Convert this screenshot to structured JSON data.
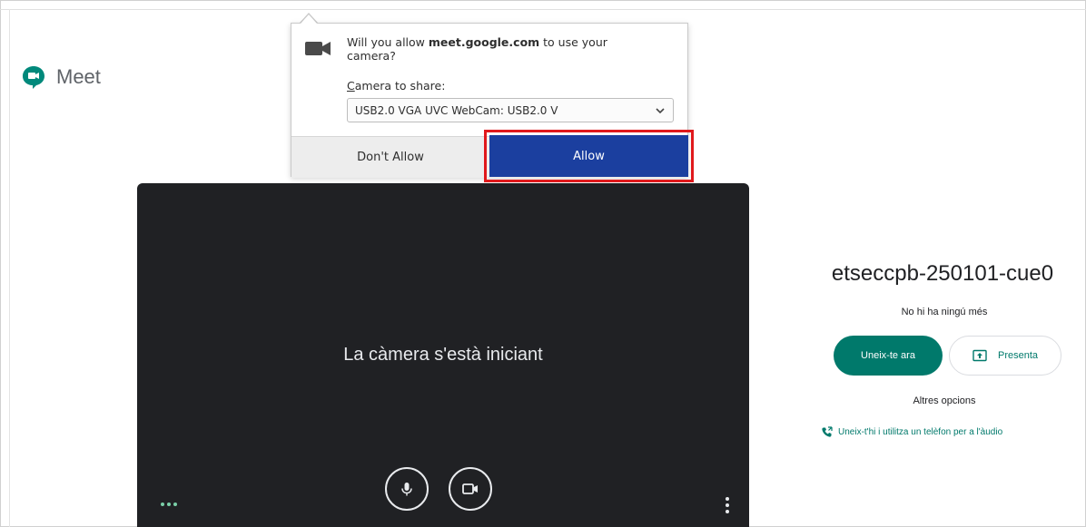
{
  "app": {
    "logo_text": "Meet",
    "brand_color": "#00897b"
  },
  "permission_popup": {
    "question_prefix": "Will you allow ",
    "question_site": "meet.google.com",
    "question_suffix": " to use your camera?",
    "camera_label": "Camera to share:",
    "camera_selected": "USB2.0 VGA UVC WebCam: USB2.0 V",
    "dont_allow_label": "Don't Allow",
    "allow_label": "Allow",
    "allow_color": "#1b3f9f",
    "highlight_color": "#e0191c",
    "icon": "video-camera-icon"
  },
  "video": {
    "status_text": "La càmera s'està iniciant",
    "background": "#202124"
  },
  "right_panel": {
    "meeting_code": "etseccpb-250101-cue0",
    "participants_status": "No hi ha ningú més",
    "join_label": "Uneix-te ara",
    "present_label": "Presenta",
    "other_options_label": "Altres opcions",
    "phone_link_label": "Uneix-t'hi i utilitza un telèfon per a l'àudio",
    "accent_color": "#00796b"
  }
}
